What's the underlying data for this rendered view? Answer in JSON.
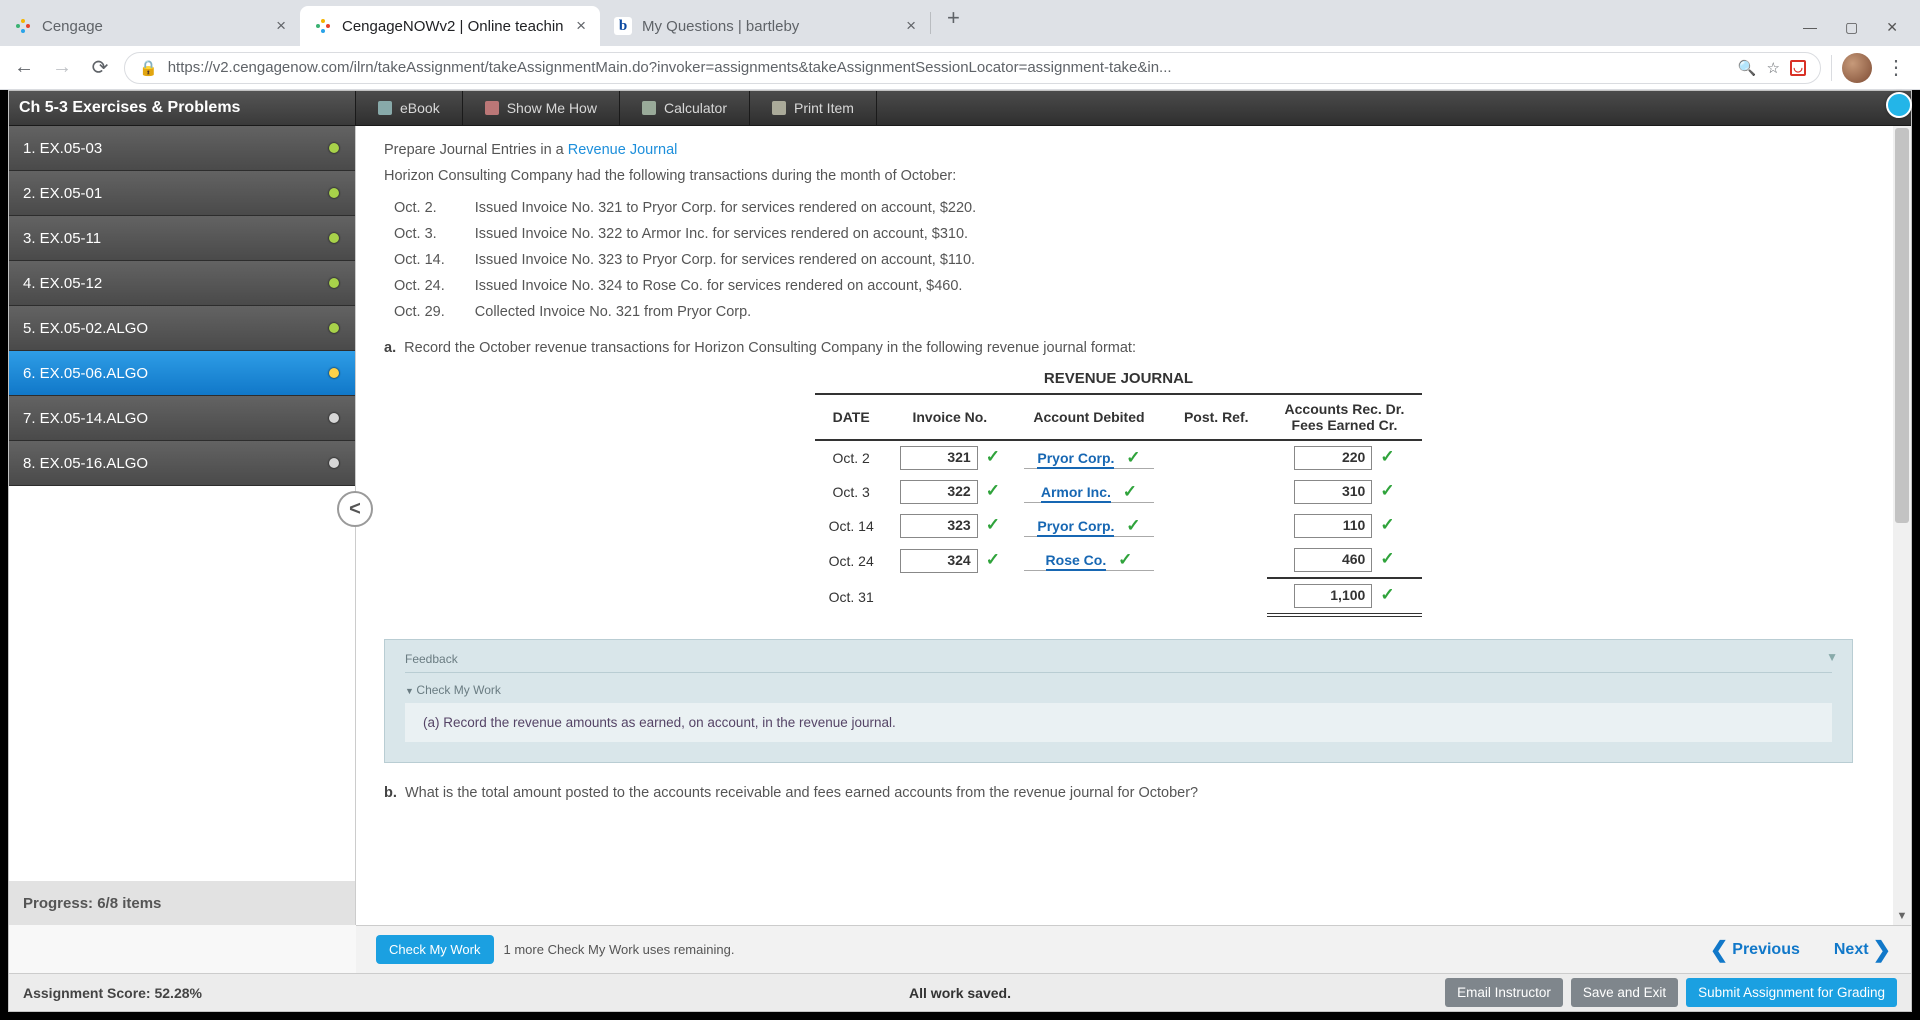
{
  "browser": {
    "tabs": [
      {
        "title": "Cengage",
        "active": false,
        "fav": "cengage"
      },
      {
        "title": "CengageNOWv2 | Online teachin",
        "active": true,
        "fav": "cengage"
      },
      {
        "title": "My Questions | bartleby",
        "active": false,
        "fav": "bartleby"
      }
    ],
    "url": "https://v2.cengagenow.com/ilrn/takeAssignment/takeAssignmentMain.do?invoker=assignments&takeAssignmentSessionLocator=assignment-take&in..."
  },
  "header": {
    "title": "Ch 5-3 Exercises & Problems",
    "buttons": [
      "eBook",
      "Show Me How",
      "Calculator",
      "Print Item"
    ]
  },
  "sidebar": {
    "items": [
      {
        "label": "1. EX.05-03",
        "status": "done"
      },
      {
        "label": "2. EX.05-01",
        "status": "done"
      },
      {
        "label": "3. EX.05-11",
        "status": "done"
      },
      {
        "label": "4. EX.05-12",
        "status": "done"
      },
      {
        "label": "5. EX.05-02.ALGO",
        "status": "done"
      },
      {
        "label": "6. EX.05-06.ALGO",
        "status": "cur"
      },
      {
        "label": "7. EX.05-14.ALGO",
        "status": "open"
      },
      {
        "label": "8. EX.05-16.ALGO",
        "status": "open"
      }
    ],
    "progress": "Progress:  6/8 items"
  },
  "content": {
    "intro_pre": "Prepare Journal Entries in a ",
    "intro_link": "Revenue Journal",
    "company_line": "Horizon Consulting Company had the following transactions during the month of October:",
    "tx": [
      {
        "d": "Oct. 2.",
        "t": "Issued Invoice No. 321 to Pryor Corp. for services rendered on account, $220."
      },
      {
        "d": "Oct. 3.",
        "t": "Issued Invoice No. 322 to Armor Inc. for services rendered on account, $310."
      },
      {
        "d": "Oct. 14.",
        "t": "Issued Invoice No. 323 to Pryor Corp. for services rendered on account, $110."
      },
      {
        "d": "Oct. 24.",
        "t": "Issued Invoice No. 324 to Rose Co. for services rendered on account, $460."
      },
      {
        "d": "Oct. 29.",
        "t": "Collected Invoice No. 321 from Pryor Corp."
      }
    ],
    "qa_label": "a.",
    "qa_text": "Record the October revenue transactions for Horizon Consulting Company in the following revenue journal format:",
    "journal_title": "REVENUE JOURNAL",
    "cols": {
      "date": "DATE",
      "inv": "Invoice No.",
      "acct": "Account Debited",
      "post": "Post. Ref.",
      "amt1": "Accounts Rec. Dr.",
      "amt2": "Fees Earned Cr."
    },
    "rows": [
      {
        "date": "Oct. 2",
        "inv": "321",
        "acct": "Pryor Corp.",
        "amt": "220"
      },
      {
        "date": "Oct. 3",
        "inv": "322",
        "acct": "Armor Inc.",
        "amt": "310"
      },
      {
        "date": "Oct. 14",
        "inv": "323",
        "acct": "Pryor Corp.",
        "amt": "110"
      },
      {
        "date": "Oct. 24",
        "inv": "324",
        "acct": "Rose Co.",
        "amt": "460"
      }
    ],
    "total_row": {
      "date": "Oct. 31",
      "amt": "1,100"
    },
    "feedback": {
      "title": "Feedback",
      "sub": "Check My Work",
      "body": "(a) Record the revenue amounts as earned, on account, in the revenue journal."
    },
    "qb_label": "b.",
    "qb_text": "What is the total amount posted to the accounts receivable and fees earned accounts from the revenue journal for October?"
  },
  "checkbar": {
    "btn": "Check My Work",
    "uses": "1 more Check My Work uses remaining.",
    "prev": "Previous",
    "next": "Next"
  },
  "footer": {
    "score": "Assignment Score: 52.28%",
    "saved": "All work saved.",
    "email": "Email Instructor",
    "save": "Save and Exit",
    "submit": "Submit Assignment for Grading"
  }
}
